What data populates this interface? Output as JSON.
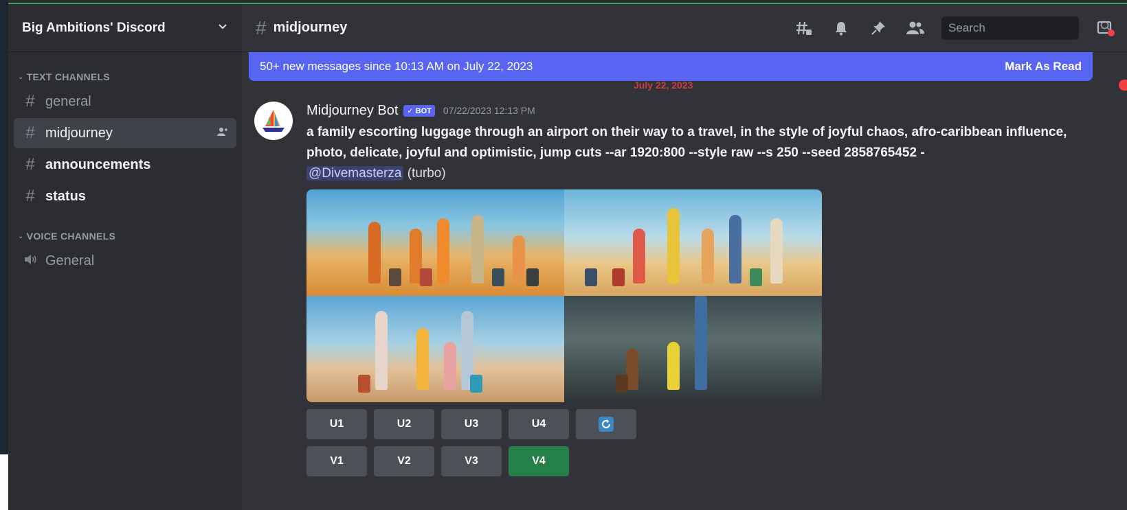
{
  "server": {
    "name": "Big Ambitions' Discord"
  },
  "sidebar": {
    "text_category": "TEXT CHANNELS",
    "voice_category": "VOICE CHANNELS",
    "channels": [
      {
        "label": "general"
      },
      {
        "label": "midjourney"
      },
      {
        "label": "announcements"
      },
      {
        "label": "status"
      }
    ],
    "voice_channels": [
      {
        "label": "General"
      }
    ]
  },
  "header": {
    "channel": "midjourney",
    "search_placeholder": "Search"
  },
  "banner": {
    "text": "50+ new messages since 10:13 AM on July 22, 2023",
    "action": "Mark As Read"
  },
  "divider": {
    "date": "July 22, 2023"
  },
  "message": {
    "author": "Midjourney Bot",
    "tag": "✓ BOT",
    "timestamp": "07/22/2023 12:13 PM",
    "prompt": "a family escorting luggage through an airport on their way to a travel, in the style of joyful chaos, afro-caribbean influence, photo, delicate, joyful and optimistic, jump cuts --ar 1920:800 --style raw --s 250 --seed 2858765452 -",
    "mention": "@Divemasterza",
    "suffix": " (turbo)"
  },
  "buttons": {
    "upscale": [
      "U1",
      "U2",
      "U3",
      "U4"
    ],
    "variation": [
      "V1",
      "V2",
      "V3",
      "V4"
    ]
  },
  "colors": {
    "blurple": "#5865f2",
    "success": "#248046",
    "sidebar_bg": "#2b2d31",
    "main_bg": "#313338"
  },
  "icons": {
    "threads": "threads-icon",
    "notifications": "bell-icon",
    "pins": "pin-icon",
    "members": "members-icon",
    "inbox": "inbox-icon",
    "reroll": "reroll-icon"
  }
}
